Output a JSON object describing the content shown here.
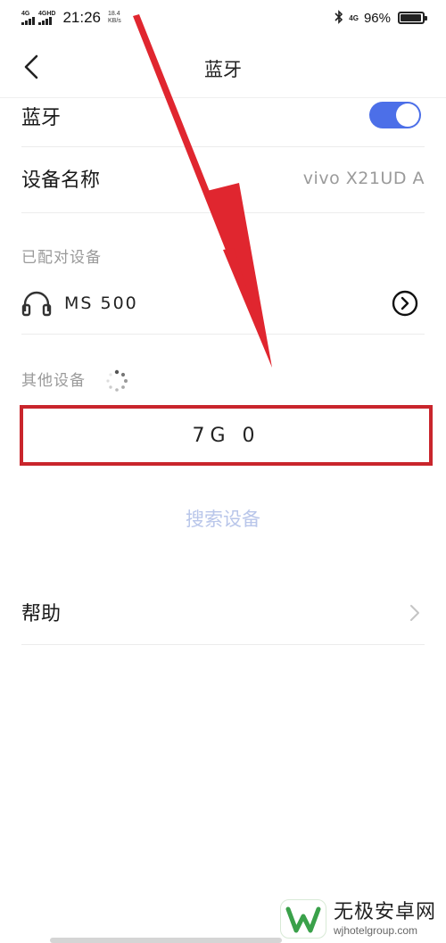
{
  "status_bar": {
    "signal1_label": "4G",
    "signal2_label": "4GHD",
    "time": "21:26",
    "speed_value": "18.4",
    "speed_unit": "KB/s",
    "network_label": "4G",
    "battery_percent": "96%",
    "battery_level": 0.96
  },
  "nav": {
    "title": "蓝牙"
  },
  "bluetooth": {
    "label": "蓝牙",
    "enabled": true,
    "toggle_color": "#4c6fe8"
  },
  "device_name": {
    "label": "设备名称",
    "value": "vivo X21UD A"
  },
  "paired_section": {
    "header": "已配对设备",
    "device_name": "MS 500",
    "icon": "headphone-icon"
  },
  "other_section": {
    "header": "其他设备",
    "device_name": "7G 0",
    "highlight_color": "#c9252c"
  },
  "search_button": {
    "label": "搜索设备"
  },
  "help": {
    "label": "帮助"
  },
  "watermark": {
    "name": "无极安卓网",
    "url": "wjhotelgroup.com"
  }
}
